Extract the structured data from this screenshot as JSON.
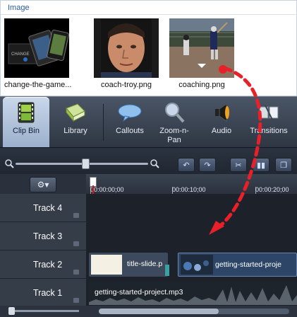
{
  "bin": {
    "title": "Image",
    "items": [
      {
        "name": "change-the-game...",
        "icon": "promo-collage-thumbnail"
      },
      {
        "name": "coach-troy.png",
        "icon": "portrait-thumbnail"
      },
      {
        "name": "coaching.png",
        "icon": "baseball-field-thumbnail"
      }
    ]
  },
  "tabs": [
    {
      "label": "Clip Bin",
      "icon": "film-strip-icon",
      "active": true
    },
    {
      "label": "Library",
      "icon": "library-book-icon"
    },
    {
      "label": "Callouts",
      "icon": "speech-bubble-icon"
    },
    {
      "label": "Zoom-n-\nPan",
      "label_line1": "Zoom-n-",
      "label_line2": "Pan",
      "icon": "magnifier-icon"
    },
    {
      "label": "Audio",
      "icon": "speaker-icon"
    },
    {
      "label": "Transitions",
      "icon": "transition-icon"
    }
  ],
  "controls": {
    "buttons": [
      "zoom-out-icon",
      "zoom-in-icon",
      "undo-icon",
      "redo-icon",
      "cut-icon",
      "split-icon",
      "copy-icon"
    ]
  },
  "timeline": {
    "gear_label": "⚙▾",
    "ruler": [
      "00:00:00;00",
      "00:00:10;00",
      "00:00:20;00"
    ],
    "tracks": [
      {
        "label": "Track 4"
      },
      {
        "label": "Track 3"
      },
      {
        "label": "Track 2",
        "clips": [
          "title-slide.p",
          "getting-started-proje"
        ]
      },
      {
        "label": "Track 1",
        "clips": [
          "getting-started-project.mp3"
        ]
      }
    ]
  },
  "colors": {
    "accent": "#2c5aa0",
    "drag_arrow": "#e8202a",
    "playhead": "#d61a1a"
  }
}
